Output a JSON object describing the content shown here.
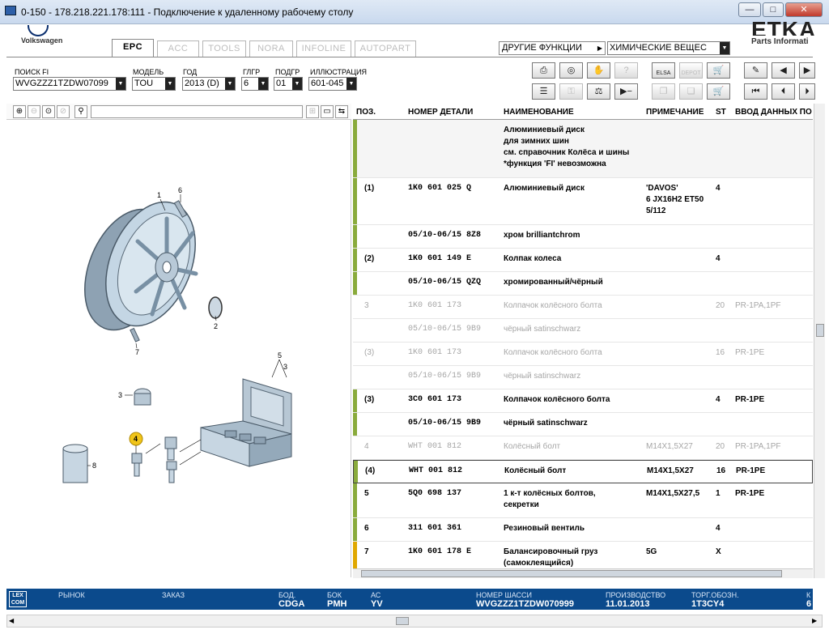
{
  "window": {
    "title": "0-150 - 178.218.221.178:111 - Подключение к удаленному рабочему столу",
    "min": "—",
    "max": "□",
    "close": "✕"
  },
  "brand": {
    "name": "Volkswagen",
    "etka": "ETKA",
    "sub": "Parts Informati"
  },
  "tabs": [
    {
      "label": "EPC"
    },
    {
      "label": "ACC"
    },
    {
      "label": "TOOLS"
    },
    {
      "label": "NORA"
    },
    {
      "label": "INFOLINE"
    },
    {
      "label": "AUTOPART"
    }
  ],
  "menu": {
    "other_functions": "ДРУГИЕ ФУНКЦИИ",
    "chem": "ХИМИЧЕСКИЕ ВЕЩЕС"
  },
  "filters": {
    "fi_label": "ПОИСК FI",
    "fi_value": "WVGZZZ1TZDW07099",
    "model_label": "МОДЕЛЬ",
    "model_value": "TOU",
    "year_label": "ГОД",
    "year_value": "2013 (D)",
    "glgr_label": "ГЛГР",
    "glgr_value": "6",
    "podgr_label": "ПОДГР",
    "podgr_value": "01",
    "ill_label": "ИЛЛЮСТРАЦИЯ",
    "ill_value": "601-045"
  },
  "toolbar": {
    "elsa": "ELSA",
    "depot": "DEPOT"
  },
  "grid": {
    "headers": {
      "pos": "ПОЗ.",
      "part": "НОМЕР ДЕТАЛИ",
      "name": "НАИМЕНОВАНИЕ",
      "note": "ПРИМЕЧАНИЕ",
      "st": "ST",
      "input": "ВВОД ДАННЫХ ПО"
    },
    "rows": [
      {
        "pos": "",
        "part": "",
        "name": "Алюминиевый диск\nдля зимних шин\nсм. справочник Колёса и шины\n*функция 'FI' невозможна",
        "note": "",
        "st": "",
        "input": "",
        "style": "bold",
        "mark": "#8aab3c",
        "h": 72
      },
      {
        "pos": "(1)",
        "part": "1K0 601 025 Q",
        "name": "Алюминиевый диск",
        "note": "'DAVOS'\n6 JX16H2 ET50\n5/112",
        "st": "4",
        "input": "",
        "style": "bold",
        "mark": "#8aab3c",
        "h": 58
      },
      {
        "pos": "",
        "part": "05/10-06/15 8Z8",
        "name": "хром brilliantchrom",
        "note": "",
        "st": "",
        "input": "",
        "style": "bold",
        "mark": "#8aab3c",
        "h": 29
      },
      {
        "pos": "(2)",
        "part": "1K0 601 149 E",
        "name": "Колпак колеса",
        "note": "",
        "st": "4",
        "input": "",
        "style": "bold",
        "mark": "#8aab3c",
        "h": 29
      },
      {
        "pos": "",
        "part": "05/10-06/15 QZQ",
        "name": "хромированный/чёрный",
        "note": "",
        "st": "",
        "input": "",
        "style": "bold",
        "mark": "#8aab3c",
        "h": 29
      },
      {
        "pos": "3",
        "part": "1K0 601 173",
        "name": "Колпачок колёсного болта",
        "note": "",
        "st": "20",
        "input": "PR-1PA,1PF",
        "style": "gray",
        "mark": "",
        "h": 29
      },
      {
        "pos": "",
        "part": "05/10-06/15 9B9",
        "name": "чёрный satinschwarz",
        "note": "",
        "st": "",
        "input": "",
        "style": "gray",
        "mark": "",
        "h": 29
      },
      {
        "pos": "(3)",
        "part": "1K0 601 173",
        "name": "Колпачок колёсного болта",
        "note": "",
        "st": "16",
        "input": "PR-1PE",
        "style": "gray",
        "mark": "",
        "h": 29
      },
      {
        "pos": "",
        "part": "05/10-06/15 9B9",
        "name": "чёрный satinschwarz",
        "note": "",
        "st": "",
        "input": "",
        "style": "gray",
        "mark": "",
        "h": 29
      },
      {
        "pos": "(3)",
        "part": "3C0 601 173",
        "name": "Колпачок колёсного болта",
        "note": "",
        "st": "4",
        "input": "PR-1PE",
        "style": "bold",
        "mark": "#8aab3c",
        "h": 29
      },
      {
        "pos": "",
        "part": "05/10-06/15 9B9",
        "name": "чёрный satinschwarz",
        "note": "",
        "st": "",
        "input": "",
        "style": "bold",
        "mark": "#8aab3c",
        "h": 29
      },
      {
        "pos": "4",
        "part": "WHT 001 812",
        "name": "Колёсный болт",
        "note": "M14X1,5X27",
        "st": "20",
        "input": "PR-1PA,1PF",
        "style": "gray",
        "mark": "",
        "h": 29
      },
      {
        "pos": "(4)",
        "part": "WHT 001 812",
        "name": "Колёсный болт",
        "note": "M14X1,5X27",
        "st": "16",
        "input": "PR-1PE",
        "style": "bold",
        "mark": "#8aab3c",
        "h": 29,
        "selected": true
      },
      {
        "pos": "5",
        "part": "5Q0 698 137",
        "name": "1 к-т колёсных болтов,\nсекретки",
        "note": "M14X1,5X27,5",
        "st": "1",
        "input": "PR-1PE",
        "style": "bold",
        "mark": "#8aab3c",
        "h": 43
      },
      {
        "pos": "6",
        "part": "311 601 361",
        "name": "Резиновый вентиль",
        "note": "",
        "st": "4",
        "input": "",
        "style": "bold",
        "mark": "#8aab3c",
        "h": 29
      },
      {
        "pos": "7",
        "part": "1K0 601 178 E",
        "name": "Балансировочный груз\n(самоклеящийся)",
        "note": "5G",
        "st": "X",
        "input": "",
        "style": "bold",
        "mark": "#e0a800",
        "h": 36
      }
    ]
  },
  "callouts": {
    "c1": "1",
    "c2": "2",
    "c3": "3",
    "c4": "4",
    "c5": "5",
    "c6": "6",
    "c7": "7",
    "c8": "8",
    "c3b": "3"
  },
  "status": {
    "lexcom": "LEX\nCOM",
    "market_label": "РЫНОК",
    "market_value": "",
    "order_label": "ЗАКАЗ",
    "order_value": "",
    "bod_label": "БОД.",
    "bod_value": "CDGA",
    "bok_label": "БОК",
    "bok_value": "PMH",
    "ac_label": "АС",
    "ac_value": "YV",
    "chassis_label": "НОМЕР ШАССИ",
    "chassis_value": "WVGZZZ1TZDW070999",
    "prod_label": "ПРОИЗВОДСТВО",
    "prod_value": "11.01.2013",
    "trade_label": "ТОРГ.ОБОЗН.",
    "trade_value": "1T3CY4",
    "extra_label": "К",
    "extra_value": "6"
  }
}
